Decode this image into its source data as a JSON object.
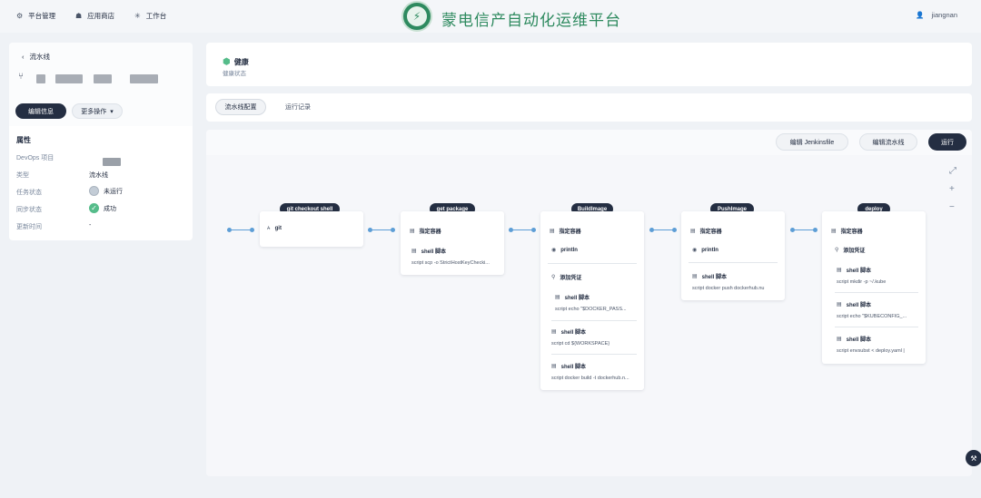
{
  "nav": {
    "items": [
      {
        "icon": "gear-icon",
        "label": "平台管理"
      },
      {
        "icon": "shop-icon",
        "label": "应用商店"
      },
      {
        "icon": "grid-icon",
        "label": "工作台"
      }
    ],
    "brand": "蒙电信产自动化运维平台",
    "user": "jiangnan"
  },
  "left": {
    "back_label": "流水线",
    "edit_button": "编辑信息",
    "more_button": "更多操作",
    "props_title": "属性",
    "props": [
      {
        "label": "DevOps 项目",
        "value": ""
      },
      {
        "label": "类型",
        "value": "流水线"
      },
      {
        "label": "任务状态",
        "value": "未运行"
      },
      {
        "label": "同步状态",
        "value": "成功"
      },
      {
        "label": "更新时间",
        "value": "-"
      }
    ]
  },
  "health": {
    "title": "健康",
    "subtitle": "健康状态"
  },
  "tabs": [
    "流水线配置",
    "运行记录"
  ],
  "toolbar": {
    "edit_jenkinsfile": "编辑 Jenkinsfile",
    "edit_pipeline": "编辑流水线",
    "run": "运行"
  },
  "stages": [
    {
      "title": "git checkout shell",
      "steps": [
        {
          "icon": "git-icon",
          "name": "git",
          "sub": ""
        }
      ]
    },
    {
      "title": "get package",
      "steps": [
        {
          "icon": "container-icon",
          "name": "指定容器",
          "sub": ""
        },
        {
          "icon": "shell-icon",
          "name": "shell 脚本",
          "sub": "script    scp -o StrictHostKeyChecki..."
        }
      ]
    },
    {
      "title": "BuildImage",
      "steps": [
        {
          "icon": "container-icon",
          "name": "指定容器",
          "sub": ""
        },
        {
          "icon": "print-icon",
          "name": "println",
          "sub": ""
        },
        {
          "icon": "credential-icon",
          "name": "添加凭证",
          "sub": ""
        },
        {
          "icon": "shell-icon",
          "name": "shell 脚本",
          "sub": "script    echo \"$DOCKER_PASS..."
        },
        {
          "icon": "shell-icon",
          "name": "shell 脚本",
          "sub": "script    cd ${WORKSPACE}"
        },
        {
          "icon": "shell-icon",
          "name": "shell 脚本",
          "sub": "script    docker build -t dockerhub.n..."
        }
      ]
    },
    {
      "title": "PushImage",
      "steps": [
        {
          "icon": "container-icon",
          "name": "指定容器",
          "sub": ""
        },
        {
          "icon": "print-icon",
          "name": "println",
          "sub": ""
        },
        {
          "icon": "shell-icon",
          "name": "shell 脚本",
          "sub": "script    docker push dockerhub.nu"
        }
      ]
    },
    {
      "title": "deploy",
      "steps": [
        {
          "icon": "container-icon",
          "name": "指定容器",
          "sub": ""
        },
        {
          "icon": "credential-icon",
          "name": "添加凭证",
          "sub": ""
        },
        {
          "icon": "shell-icon",
          "name": "shell 脚本",
          "sub": "script    mkdir -p ~/.kube"
        },
        {
          "icon": "shell-icon",
          "name": "shell 脚本",
          "sub": "script    echo \"$KUBECONFIG_..."
        },
        {
          "icon": "shell-icon",
          "name": "shell 脚本",
          "sub": "script    envsubst < deploy.yaml |"
        }
      ]
    }
  ]
}
